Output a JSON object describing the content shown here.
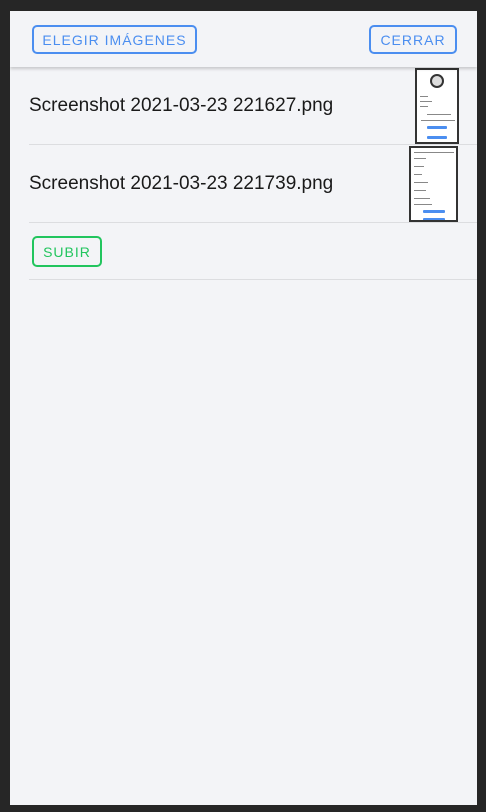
{
  "header": {
    "choose_label": "ELEGIR IMÁGENES",
    "close_label": "CERRAR"
  },
  "files": [
    {
      "name": "Screenshot 2021-03-23 221627.png"
    },
    {
      "name": "Screenshot 2021-03-23 221739.png"
    }
  ],
  "upload": {
    "label": "SUBIR"
  },
  "colors": {
    "accent": "#4b8ef0",
    "upload": "#22c55e",
    "background": "#f3f4f7",
    "frame": "#262626"
  }
}
